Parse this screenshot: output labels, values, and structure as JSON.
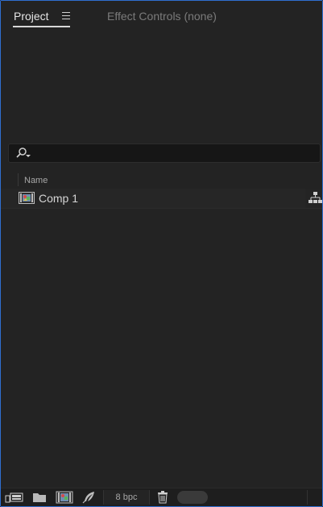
{
  "tabs": {
    "project": "Project",
    "effect_controls": "Effect Controls (none)"
  },
  "search": {
    "value": "",
    "placeholder": ""
  },
  "list": {
    "columns": [
      "Name"
    ],
    "items": [
      {
        "label": "Comp 1",
        "type": "composition"
      }
    ]
  },
  "footer": {
    "bpc_label": "8 bpc",
    "buttons": [
      "interpret-footage-icon",
      "new-folder-icon",
      "new-composition-icon",
      "flowchart-feather-icon",
      "trash-icon"
    ]
  },
  "colors": {
    "panel_bg": "#232323",
    "focus_border": "#2f6fd1",
    "active_tab_text": "#e6e6e6",
    "inactive_tab_text": "#7b7b7b"
  }
}
